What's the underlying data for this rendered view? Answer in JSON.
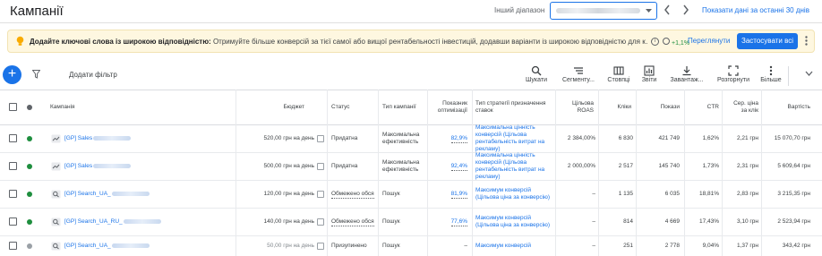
{
  "header": {
    "title": "Кампанії",
    "range_label": "Інший діапазон",
    "range_link": "Показати дані за останні 30 днів"
  },
  "banner": {
    "title": "Додайте ключові слова із широкою відповідністю:",
    "text": "Отримуйте більше конверсій за тієї самої або вищої рентабельності інвестицій, додавши варіанти із широкою відповідністю для к…",
    "uplift": "+1,1%",
    "review_label": "Переглянути",
    "apply_label": "Застосувати всі",
    "colors": {
      "background": "#fef7e0",
      "accent": "#1a73e8"
    }
  },
  "toolbar": {
    "add_filter": "Додати фільтр",
    "tools": [
      {
        "label": "Шукати",
        "icon": "search-icon"
      },
      {
        "label": "Сегменту...",
        "icon": "segment-icon"
      },
      {
        "label": "Стовпці",
        "icon": "columns-icon"
      },
      {
        "label": "Звіти",
        "icon": "reports-icon"
      },
      {
        "label": "Завантаж...",
        "icon": "download-icon"
      },
      {
        "label": "Розгорнути",
        "icon": "expand-icon"
      },
      {
        "label": "Більше",
        "icon": "more-vert-icon"
      }
    ]
  },
  "table": {
    "columns": {
      "campaign": "Кампанія",
      "budget": "Бюджет",
      "status": "Статус",
      "type": "Тип кампанії",
      "opt": "Показник оптимізації",
      "strategy": "Тип стратегії призначення ставок",
      "roas": "Цільова ROAS",
      "clicks": "Кліки",
      "impr": "Покази",
      "ctr": "CTR",
      "cpc": "Сер. ціна за клік",
      "cost": "Вартість"
    },
    "rows": [
      {
        "name": "[GP] Sales",
        "kind": "pmax",
        "status_dot": "active",
        "budget": "520,00 грн на день",
        "status": "Придатна",
        "type": "Максимальна ефективність",
        "opt": "82,9%",
        "strategy": "Максимальна цінність конверсій (Цільова рентабельність витрат на рекламу)",
        "roas": "2 384,00%",
        "clicks": "6 830",
        "impr": "421 749",
        "ctr": "1,62%",
        "cpc": "2,21 грн",
        "cost": "15 070,70 грн"
      },
      {
        "name": "[GP] Sales",
        "kind": "pmax",
        "status_dot": "active",
        "budget": "500,00 грн на день",
        "status": "Придатна",
        "type": "Максимальна ефективність",
        "opt": "92,4%",
        "strategy": "Максимальна цінність конверсій (Цільова рентабельність витрат на рекламу)",
        "roas": "2 000,00%",
        "clicks": "2 517",
        "impr": "145 740",
        "ctr": "1,73%",
        "cpc": "2,31 грн",
        "cost": "5 609,64 грн"
      },
      {
        "name": "[GP] Search_UA_",
        "kind": "search",
        "status_dot": "active",
        "budget": "120,00 грн на день",
        "status": "Обмежено обся",
        "type": "Пошук",
        "opt": "81,9%",
        "strategy": "Максимум конверсій (Цільова ціна за конверсію)",
        "roas": "–",
        "clicks": "1 135",
        "impr": "6 035",
        "ctr": "18,81%",
        "cpc": "2,83 грн",
        "cost": "3 215,35 грн"
      },
      {
        "name": "[GP] Search_UA_RU_",
        "kind": "search",
        "status_dot": "active",
        "budget": "140,00 грн на день",
        "status": "Обмежено обся",
        "type": "Пошук",
        "opt": "77,6%",
        "strategy": "Максимум конверсій (Цільова ціна за конверсію)",
        "roas": "–",
        "clicks": "814",
        "impr": "4 669",
        "ctr": "17,43%",
        "cpc": "3,10 грн",
        "cost": "2 523,94 грн"
      },
      {
        "name": "[GP] Search_UA_",
        "kind": "search",
        "status_dot": "paused",
        "budget": "50,00 грн на день",
        "status": "Призупинено",
        "type": "Пошук",
        "opt": "–",
        "strategy": "Максимум конверсій",
        "roas": "–",
        "clicks": "251",
        "impr": "2 778",
        "ctr": "9,04%",
        "cpc": "1,37 грн",
        "cost": "343,42 грн"
      }
    ]
  }
}
